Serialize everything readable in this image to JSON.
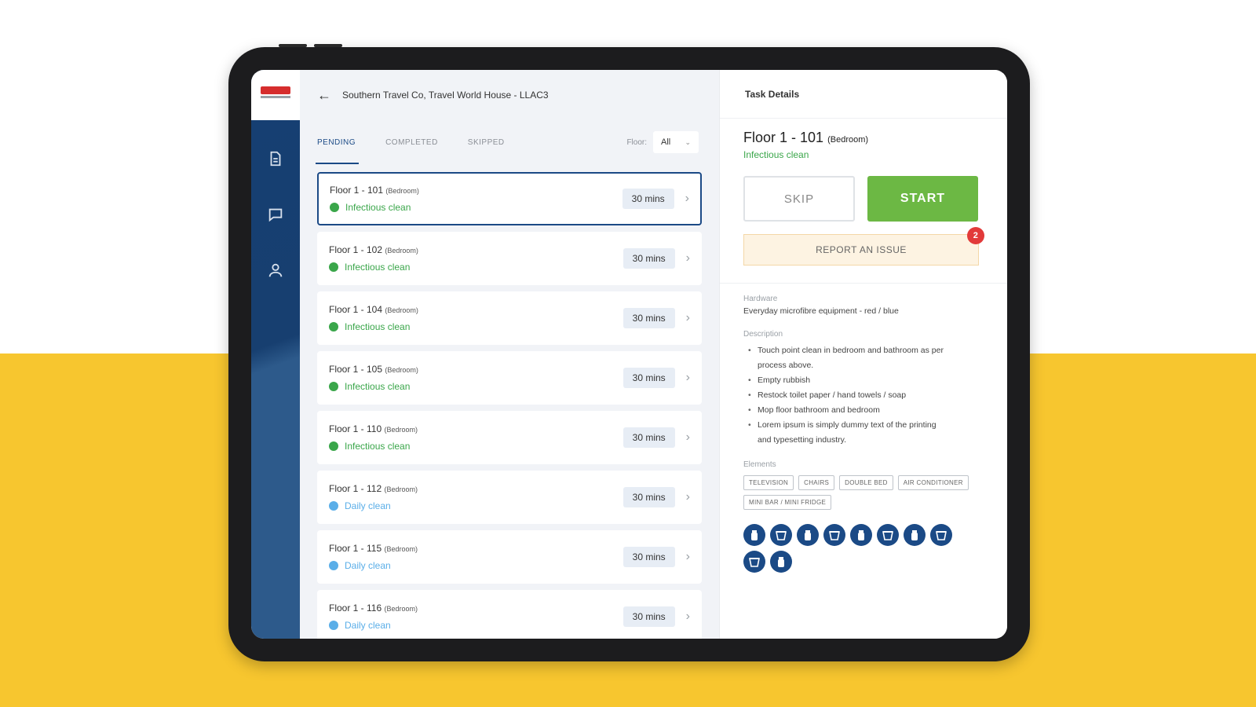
{
  "header": {
    "back_icon": "arrow-left-icon",
    "title": "Southern Travel Co, Travel World House - LLAC3"
  },
  "sidebar": {
    "items": [
      {
        "icon": "document-icon"
      },
      {
        "icon": "chat-icon"
      },
      {
        "icon": "user-icon"
      }
    ]
  },
  "tabs": [
    {
      "label": "PENDING",
      "active": true
    },
    {
      "label": "COMPLETED",
      "active": false
    },
    {
      "label": "SKIPPED",
      "active": false
    }
  ],
  "filter": {
    "label": "Floor:",
    "value": "All"
  },
  "tasks": [
    {
      "name": "Floor 1 - 101",
      "sub": "(Bedroom)",
      "type": "Infectious clean",
      "type_color": "#3aa64a",
      "mins": "30 mins",
      "selected": true
    },
    {
      "name": "Floor 1 - 102",
      "sub": "(Bedroom)",
      "type": "Infectious clean",
      "type_color": "#3aa64a",
      "mins": "30 mins",
      "selected": false
    },
    {
      "name": "Floor 1 - 104",
      "sub": "(Bedroom)",
      "type": "Infectious clean",
      "type_color": "#3aa64a",
      "mins": "30 mins",
      "selected": false
    },
    {
      "name": "Floor 1 - 105",
      "sub": "(Bedroom)",
      "type": "Infectious clean",
      "type_color": "#3aa64a",
      "mins": "30 mins",
      "selected": false
    },
    {
      "name": "Floor 1 - 110",
      "sub": "(Bedroom)",
      "type": "Infectious clean",
      "type_color": "#3aa64a",
      "mins": "30 mins",
      "selected": false
    },
    {
      "name": "Floor 1 - 112",
      "sub": "(Bedroom)",
      "type": "Daily clean",
      "type_color": "#5aaee8",
      "mins": "30 mins",
      "selected": false
    },
    {
      "name": "Floor 1 - 115",
      "sub": "(Bedroom)",
      "type": "Daily clean",
      "type_color": "#5aaee8",
      "mins": "30 mins",
      "selected": false
    },
    {
      "name": "Floor 1 - 116",
      "sub": "(Bedroom)",
      "type": "Daily clean",
      "type_color": "#5aaee8",
      "mins": "30 mins",
      "selected": false
    }
  ],
  "details": {
    "header": "Task Details",
    "title": "Floor 1 - 101",
    "title_sub": "(Bedroom)",
    "type": "Infectious clean",
    "skip_label": "SKIP",
    "start_label": "START",
    "report_label": "REPORT AN ISSUE",
    "report_badge": "2",
    "hardware_label": "Hardware",
    "hardware_value": "Everyday microfibre equipment - red / blue",
    "description_label": "Description",
    "description_items": [
      "Touch point clean in bedroom and bathroom as per",
      "Empty rubbish",
      "Restock toilet paper / hand towels / soap",
      "Mop floor bathroom and bedroom",
      "Lorem ipsum is simply dummy text of the printing"
    ],
    "description_continuations": [
      "process above.",
      "and typesetting industry."
    ],
    "elements_label": "Elements",
    "elements": [
      "TELEVISION",
      "CHAIRS",
      "DOUBLE BED",
      "AIR CONDITIONER",
      "MINI BAR / MINI FRIDGE"
    ],
    "hardware_icons": [
      "bottle-icon",
      "bucket-icon",
      "bottle-icon",
      "bucket-icon",
      "bottle-icon",
      "bucket-icon",
      "bottle-icon",
      "bucket-icon",
      "bucket-icon",
      "bottle-icon"
    ]
  },
  "colors": {
    "brand_navy": "#1b4a86",
    "start_green": "#6cb844",
    "report_bg": "#fdf3e2",
    "badge_red": "#e23a3a",
    "background_yellow": "#f7c62f"
  }
}
